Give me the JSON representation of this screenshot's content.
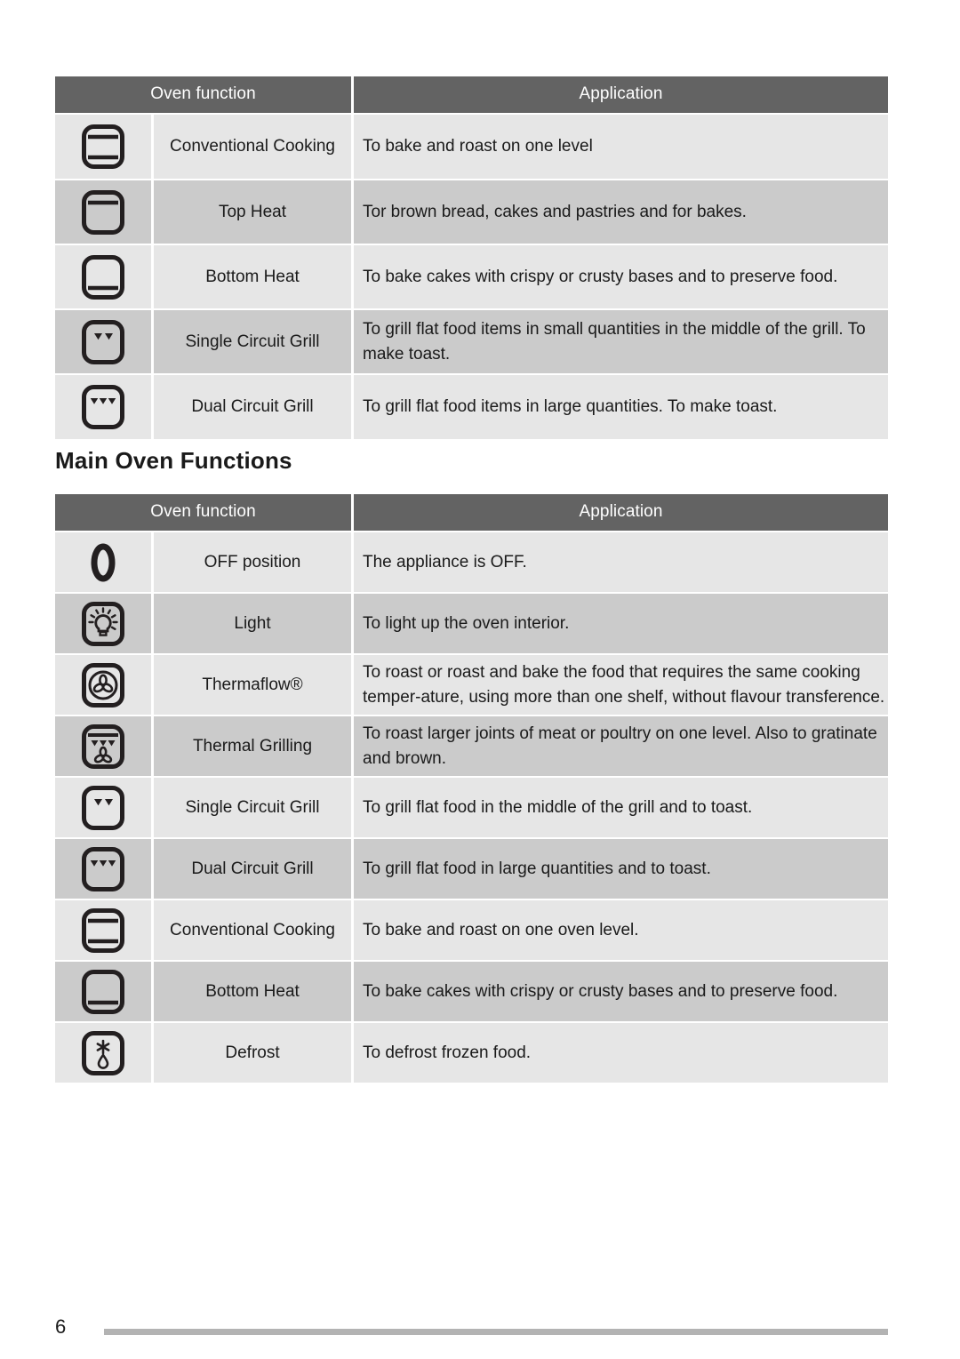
{
  "page": {
    "number": "6"
  },
  "section_heading": "Main Oven Functions",
  "tables": [
    {
      "headers": {
        "function": "Oven function",
        "application": "Application"
      },
      "rows": [
        {
          "icon": "conventional-cooking-icon",
          "name": "Conventional Cooking",
          "application": "To bake and roast on one level"
        },
        {
          "icon": "top-heat-icon",
          "name": "Top Heat",
          "application": "Tor brown bread, cakes and pastries and for bakes."
        },
        {
          "icon": "bottom-heat-icon",
          "name": "Bottom Heat",
          "application": "To bake cakes with crispy or crusty bases and to preserve food."
        },
        {
          "icon": "single-circuit-grill-icon",
          "name": "Single Circuit Grill",
          "application": "To grill flat food items in small quantities in the middle of the grill. To make toast."
        },
        {
          "icon": "dual-circuit-grill-icon",
          "name": "Dual Circuit Grill",
          "application": "To grill flat food items in large quantities. To make toast."
        }
      ]
    },
    {
      "headers": {
        "function": "Oven function",
        "application": "Application"
      },
      "rows": [
        {
          "icon": "off-position-icon",
          "name": "OFF position",
          "application": "The appliance is OFF."
        },
        {
          "icon": "light-icon",
          "name": "Light",
          "application": "To light up the oven interior."
        },
        {
          "icon": "thermaflow-fan-icon",
          "name": "Thermaflow®",
          "application": "To roast or roast and bake the food that requires the same cooking temper-ature, using more than one shelf, without flavour transference."
        },
        {
          "icon": "thermal-grilling-icon",
          "name": "Thermal Grilling",
          "application": "To roast larger joints of meat or poultry on one level. Also to gratinate and brown."
        },
        {
          "icon": "single-circuit-grill-icon",
          "name": "Single Circuit Grill",
          "application": "To grill flat food in the middle of the grill and to toast."
        },
        {
          "icon": "dual-circuit-grill-icon",
          "name": "Dual Circuit Grill",
          "application": "To grill flat food in large quantities and to toast."
        },
        {
          "icon": "conventional-cooking-icon",
          "name": "Conventional Cooking",
          "application": "To bake and roast on one oven level."
        },
        {
          "icon": "bottom-heat-icon",
          "name": "Bottom Heat",
          "application": "To bake cakes with crispy or crusty bases and to preserve food."
        },
        {
          "icon": "defrost-icon",
          "name": "Defrost",
          "application": "To defrost frozen food."
        }
      ]
    }
  ],
  "colors": {
    "header_bar": "#636363",
    "row_light": "#e6e6e6",
    "row_dark": "#cbcbcb",
    "footer_rule": "#b3b3b3",
    "text": "#1a1a1a"
  }
}
